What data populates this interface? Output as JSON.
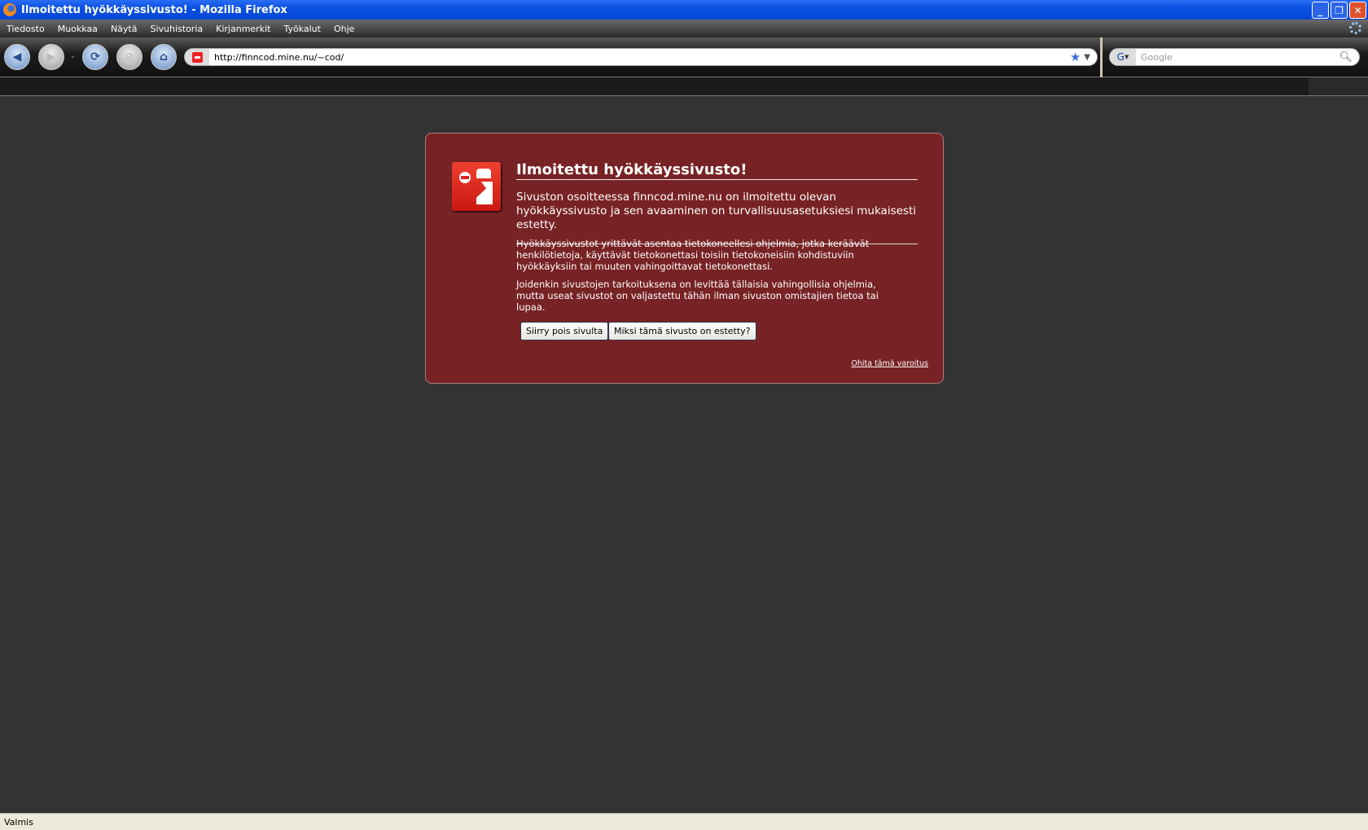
{
  "window": {
    "title": "Ilmoitettu hyökkäyssivusto! - Mozilla Firefox"
  },
  "menu": [
    "Tiedosto",
    "Muokkaa",
    "Näytä",
    "Sivuhistoria",
    "Kirjanmerkit",
    "Työkalut",
    "Ohje"
  ],
  "toolbar": {
    "url": "http://finncod.mine.nu/~cod/",
    "search_placeholder": "Google",
    "search_engine": "G"
  },
  "warning": {
    "title": "Ilmoitettu hyökkäyssivusto!",
    "intro": "Sivuston osoitteessa finncod.mine.nu on ilmoitettu olevan hyökkäyssivusto ja sen avaaminen on turvallisuusasetuksiesi mukaisesti estetty.",
    "para1": "Hyökkäyssivustot yrittävät asentaa tietokoneellesi ohjelmia, jotka keräävät henkilötietoja, käyttävät tietokonettasi toisiin tietokoneisiin kohdistuviin hyökkäyksiin tai muuten vahingoittavat tietokonettasi.",
    "para2": "Joidenkin sivustojen tarkoituksena on levittää tällaisia vahingollisia ohjelmia, mutta useat sivustot on valjastettu tähän ilman sivuston omistajien tietoa tai lupaa.",
    "get_me_out": "Siirry pois sivulta",
    "why_blocked": "Miksi tämä sivusto on estetty?",
    "ignore": "Ohita tämä varoitus"
  },
  "status": "Valmis"
}
